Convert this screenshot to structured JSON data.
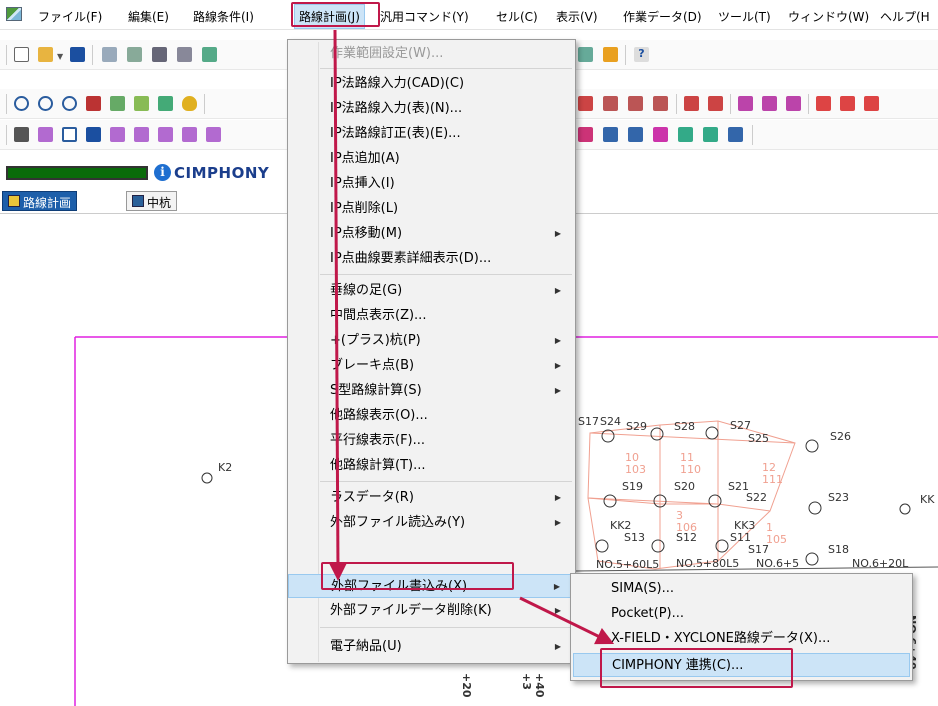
{
  "menubar": {
    "items": [
      "ファイル(F)",
      "編集(E)",
      "路線条件(I)",
      "路線計画(J)",
      "汎用コマンド(Y)",
      "セル(C)",
      "表示(V)",
      "作業データ(D)",
      "ツール(T)",
      "ウィンドウ(W)",
      "ヘルプ(H"
    ]
  },
  "logo": {
    "text": "CIMPHONY"
  },
  "tabs": [
    "路線計画",
    "中杭"
  ],
  "menu": {
    "items": [
      "作業範囲設定(W)...",
      "IP法路線入力(CAD)(C)",
      "IP法路線入力(表)(N)...",
      "IP法路線訂正(表)(E)...",
      "IP点追加(A)",
      "IP点挿入(I)",
      "IP点削除(L)",
      "IP点移動(M)",
      "IP点曲線要素詳細表示(D)...",
      "垂線の足(G)",
      "中間点表示(Z)...",
      "+(プラス)杭(P)",
      "ブレーキ点(B)",
      "S型路線計算(S)",
      "他路線表示(O)...",
      "平行線表示(F)...",
      "他路線計算(T)...",
      "ラスデータ(R)",
      "外部ファイル読込み(Y)",
      "外部ファイル書込み(X)",
      "外部ファイルデータ削除(K)",
      "電子納品(U)"
    ]
  },
  "submenu": {
    "items": [
      "SIMA(S)...",
      "Pocket(P)...",
      "X-FIELD・XYCLONE路線データ(X)...",
      "CIMPHONY 連携(C)..."
    ]
  },
  "drawing": {
    "points": [
      "K2",
      "S17",
      "S24",
      "S29",
      "S28",
      "S27",
      "S25",
      "S26",
      "S19",
      "S20",
      "S21",
      "S22",
      "S23",
      "KK",
      "KK2",
      "S13",
      "S12",
      "S11",
      "S17",
      "S18",
      "KK3"
    ],
    "numbers": [
      "10",
      "103",
      "11",
      "110",
      "12",
      "111",
      "3",
      "106",
      "1",
      "105"
    ],
    "stations": [
      "NO.5+60L5",
      "NO.5+80L5",
      "NO.6+5",
      "NO.6+20L",
      "NO.6+40",
      "+20",
      "+40",
      "+3"
    ]
  },
  "colors": {
    "highlight": "#c0184a",
    "selection": "#cce4f7",
    "frame": "#e020e0",
    "grid": "#f0a090"
  }
}
